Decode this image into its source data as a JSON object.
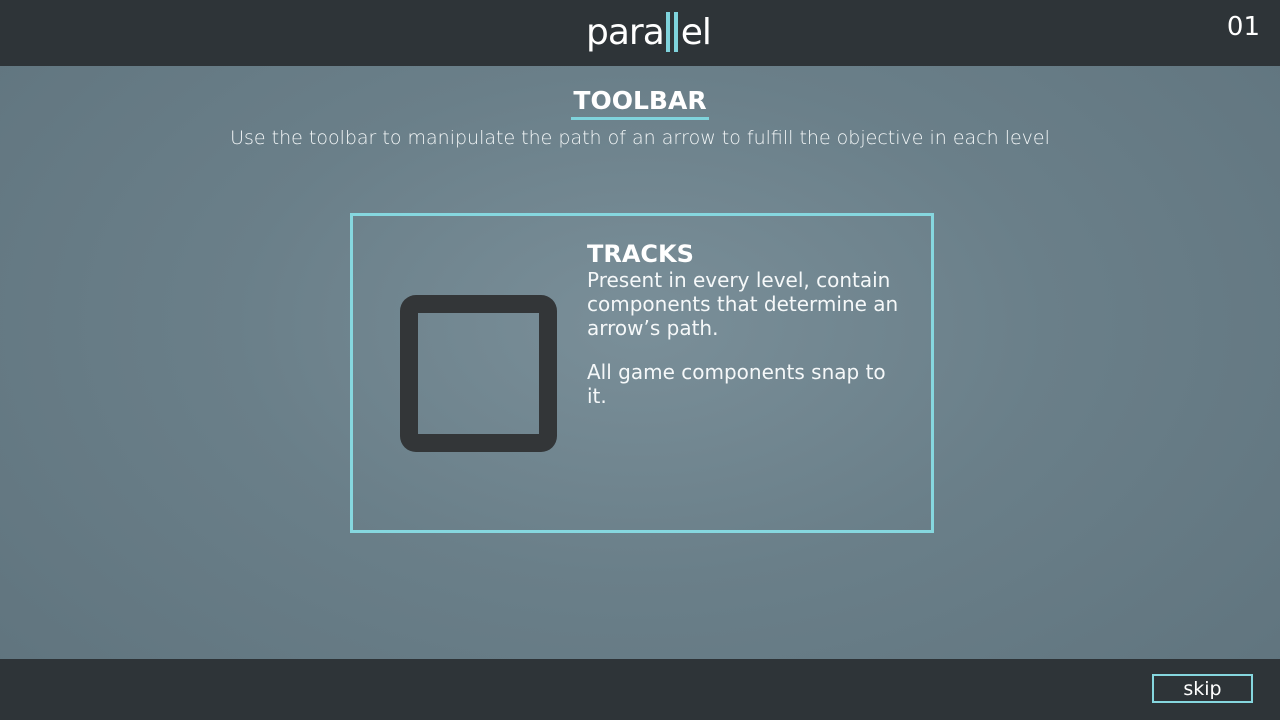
{
  "header": {
    "logo_left": "para",
    "logo_right": "el",
    "level_number": "01"
  },
  "intro": {
    "title": "TOOLBAR",
    "subtitle": "Use the toolbar to manipulate the path of an arrow to fulfill the objective in each level"
  },
  "panel": {
    "icon": "track-square-icon",
    "heading": "TRACKS",
    "paragraphs": [
      "Present in every level,  contain components that determine an arrow’s path.",
      "All game components snap to it."
    ]
  },
  "footer": {
    "skip_label": "skip"
  },
  "colors": {
    "bar_background": "#2e3438",
    "accent": "#7fd3dc",
    "track_icon": "#333638"
  }
}
